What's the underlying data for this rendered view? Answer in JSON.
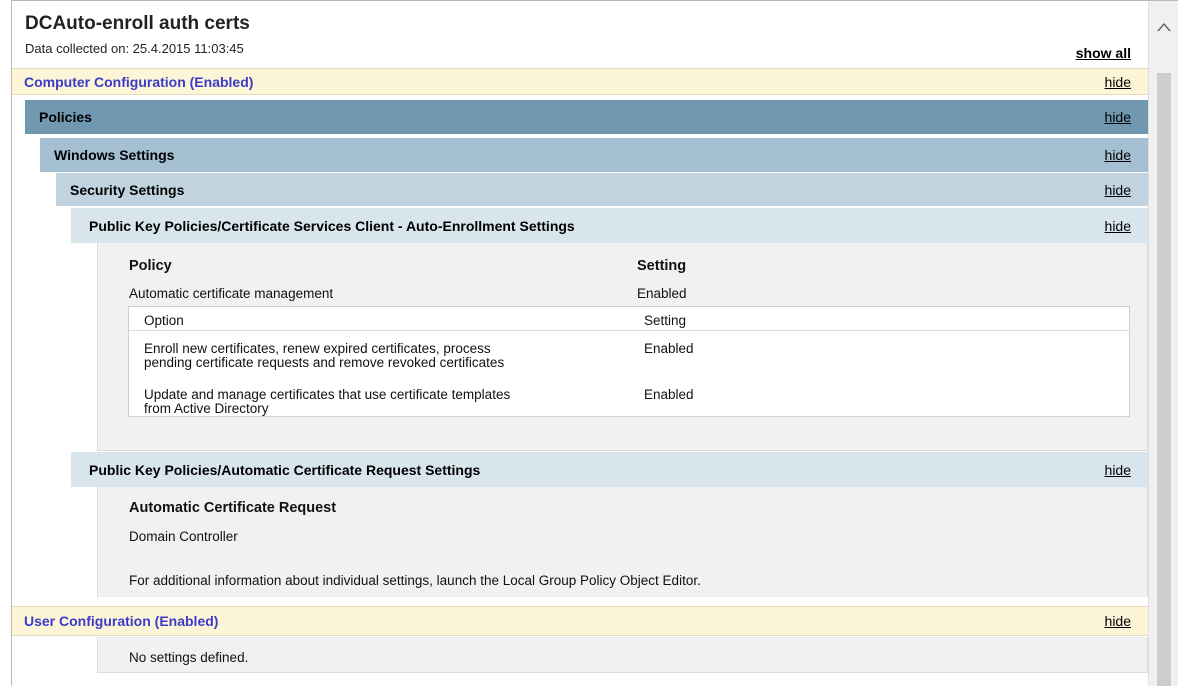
{
  "report": {
    "title": "DCAuto-enroll auth certs",
    "collected": "Data collected on: 25.4.2015 11:03:45",
    "show_all": "show all",
    "hide": "hide"
  },
  "computer_config": {
    "label": "Computer Configuration (Enabled)",
    "policies": "Policies",
    "windows_settings": "Windows Settings",
    "security_settings": "Security Settings",
    "auto_enroll": {
      "label": "Public Key Policies/Certificate Services Client - Auto-Enrollment Settings",
      "col_policy": "Policy",
      "col_setting": "Setting",
      "policy_name": "Automatic certificate management",
      "policy_value": "Enabled",
      "options_header": [
        "Option",
        "Setting"
      ],
      "options": [
        {
          "line1": "Enroll new certificates, renew expired certificates, process",
          "line2": "pending certificate requests and remove revoked certificates",
          "value": "Enabled"
        },
        {
          "line1": "Update and manage certificates that use certificate templates",
          "line2": "from Active Directory",
          "value": "Enabled"
        }
      ]
    },
    "auto_request": {
      "label": "Public Key Policies/Automatic Certificate Request Settings",
      "heading": "Automatic Certificate Request",
      "value": "Domain Controller",
      "note": "For additional information about individual settings, launch the Local Group Policy Object Editor."
    }
  },
  "user_config": {
    "label": "User Configuration (Enabled)",
    "note": "No settings defined."
  }
}
